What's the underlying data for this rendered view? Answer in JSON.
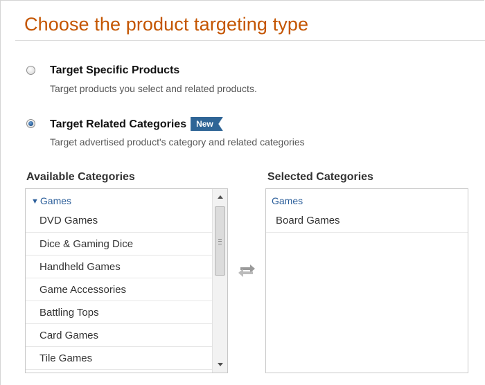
{
  "page": {
    "heading": "Choose the product targeting type"
  },
  "options": [
    {
      "title": "Target Specific Products",
      "description": "Target products you select and related products.",
      "selected": false
    },
    {
      "title": "Target Related Categories",
      "badge": "New",
      "description": "Target advertised product's category and related categories",
      "selected": true
    }
  ],
  "available": {
    "label": "Available Categories",
    "group": "Games",
    "items": [
      "DVD Games",
      "Dice & Gaming Dice",
      "Handheld Games",
      "Game Accessories",
      "Battling Tops",
      "Card Games",
      "Tile Games"
    ]
  },
  "selected": {
    "label": "Selected Categories",
    "group": "Games",
    "items": [
      "Board Games"
    ]
  },
  "icons": {
    "expand": "triangle-down-icon",
    "swap": "swap-arrows-icon",
    "scroll_up": "arrow-up-icon",
    "scroll_down": "arrow-down-icon"
  },
  "colors": {
    "heading": "#c45500",
    "badge": "#2f6596",
    "link": "#2b5e9a"
  }
}
